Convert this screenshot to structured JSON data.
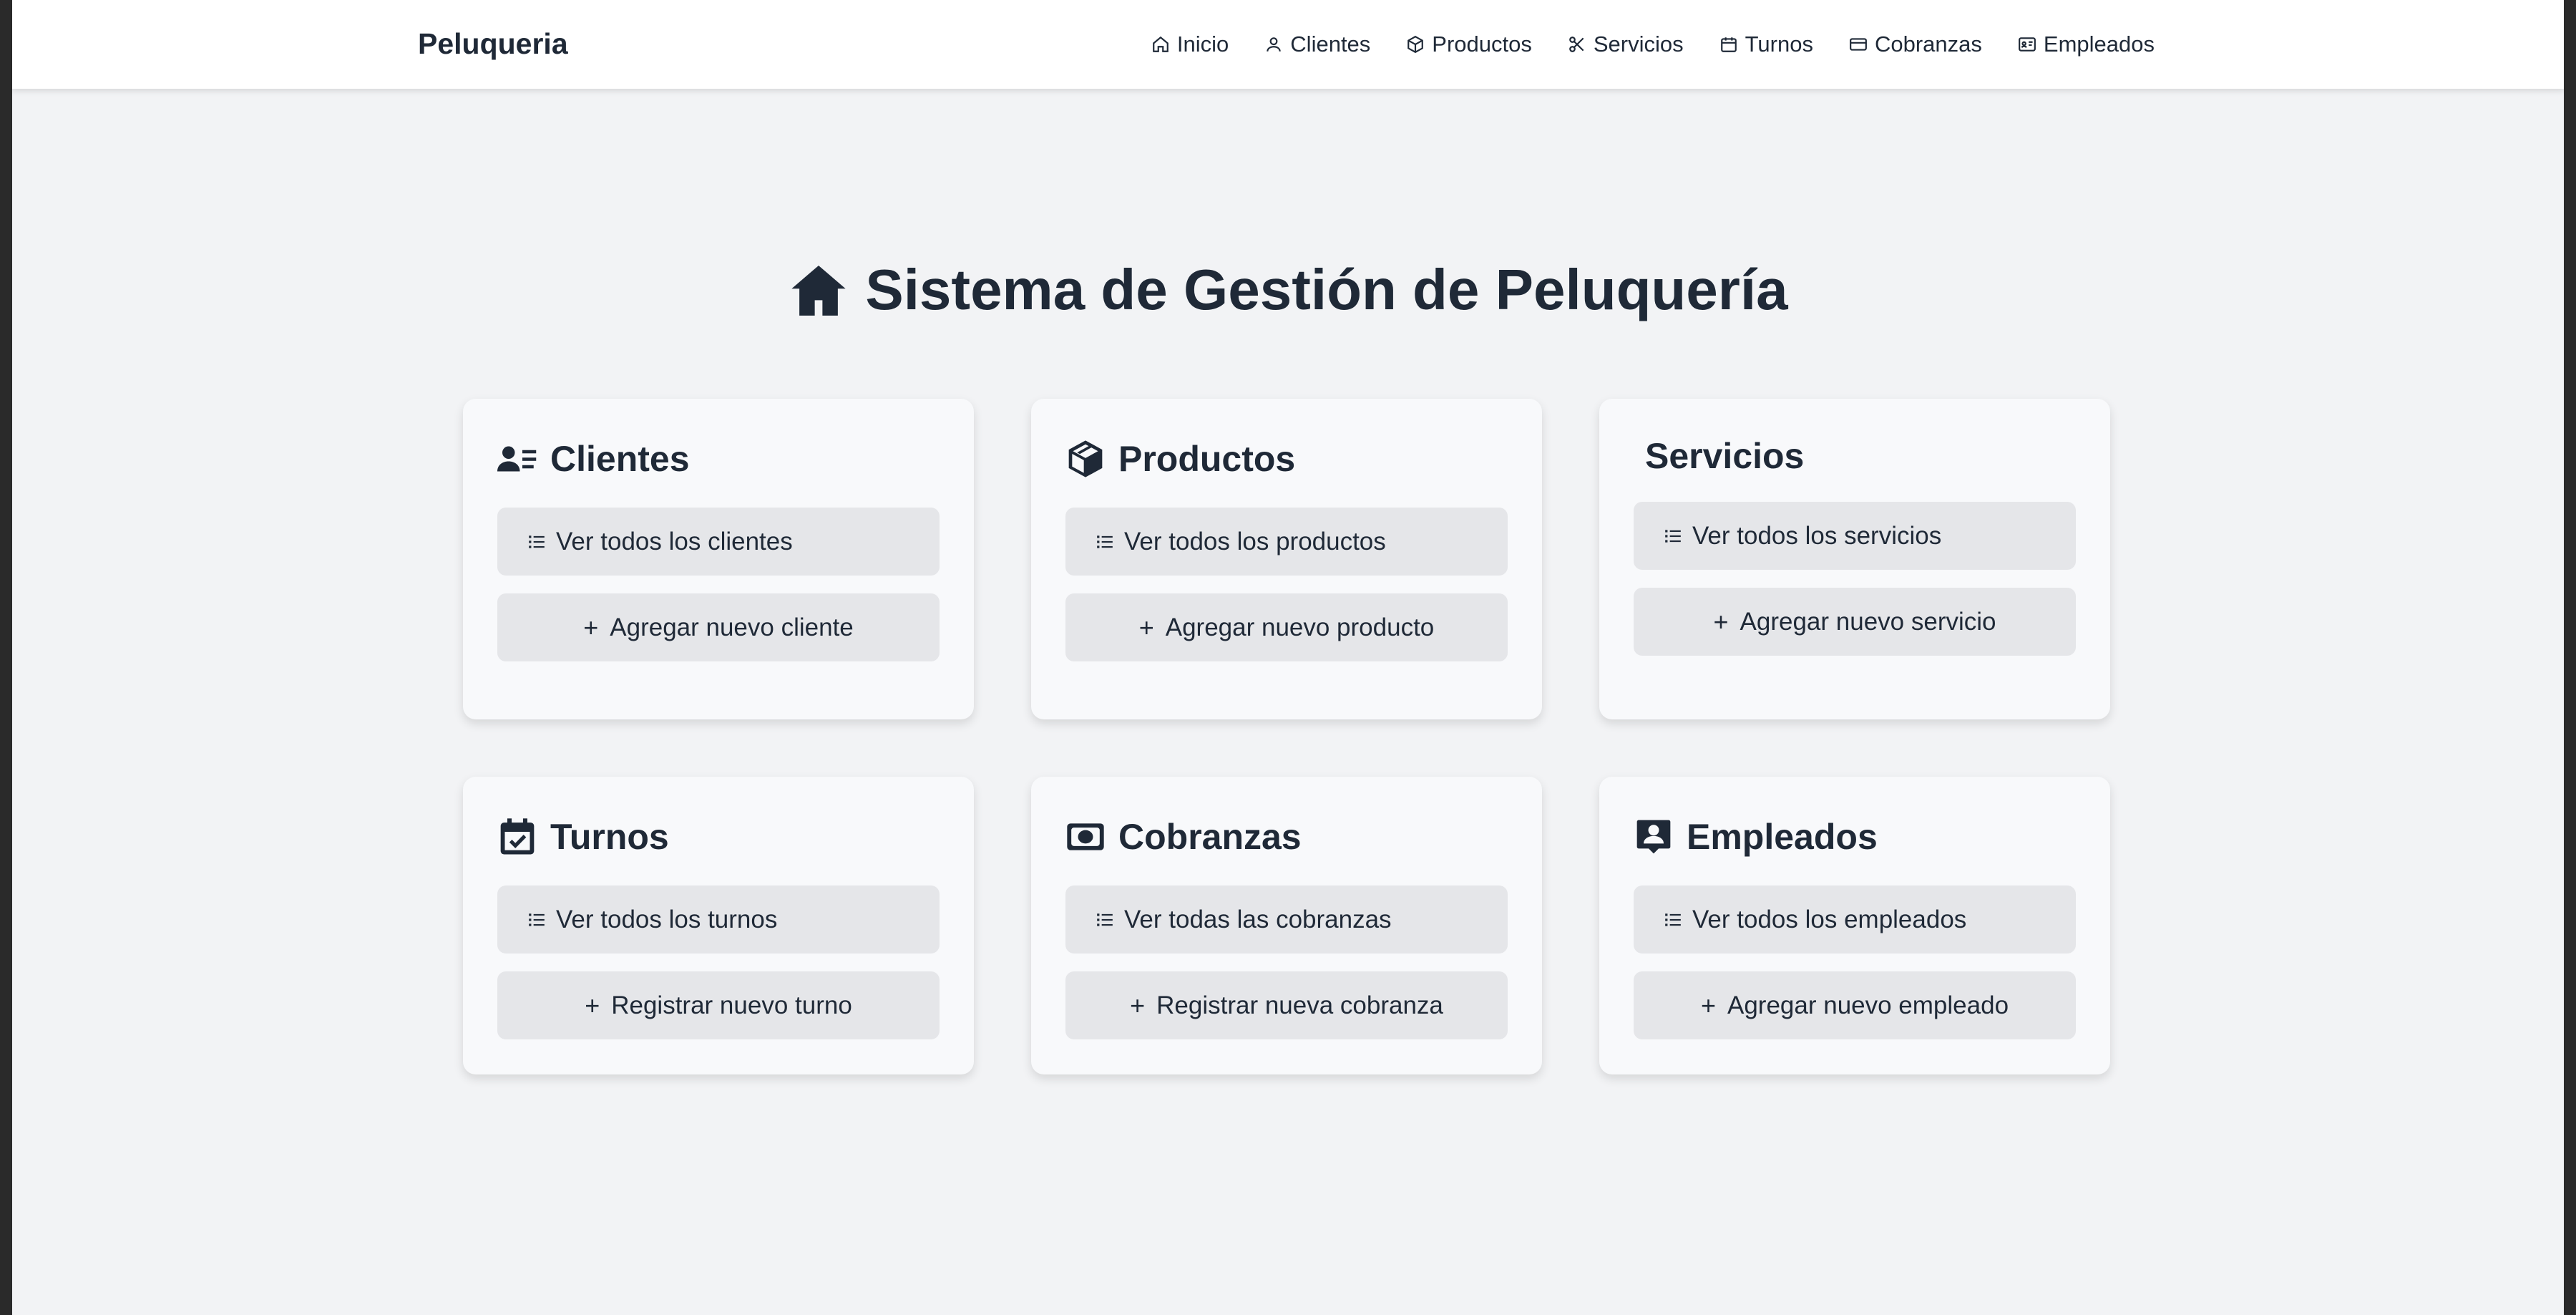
{
  "brand": "Peluqueria",
  "nav": [
    {
      "label": "Inicio",
      "icon": "home-icon"
    },
    {
      "label": "Clientes",
      "icon": "user-icon"
    },
    {
      "label": "Productos",
      "icon": "box-icon"
    },
    {
      "label": "Servicios",
      "icon": "scissors-icon"
    },
    {
      "label": "Turnos",
      "icon": "calendar-icon"
    },
    {
      "label": "Cobranzas",
      "icon": "credit-card-icon"
    },
    {
      "label": "Empleados",
      "icon": "id-card-icon"
    }
  ],
  "title": "Sistema de Gestión de Peluquería",
  "title_icon": "home-solid-icon",
  "cards": [
    {
      "title": "Clientes",
      "icon": "address-card-icon",
      "list_label": "Ver todos los clientes",
      "add_label": "Agregar nuevo cliente"
    },
    {
      "title": "Productos",
      "icon": "box-open-icon",
      "list_label": "Ver todos los productos",
      "add_label": "Agregar nuevo producto"
    },
    {
      "title": "Servicios",
      "icon": "",
      "list_label": "Ver todos los servicios",
      "add_label": "Agregar nuevo servicio"
    },
    {
      "title": "Turnos",
      "icon": "calendar-check-icon",
      "list_label": "Ver todos los turnos",
      "add_label": "Registrar nuevo turno"
    },
    {
      "title": "Cobranzas",
      "icon": "money-bill-icon",
      "list_label": "Ver todas las cobranzas",
      "add_label": "Registrar nueva cobranza"
    },
    {
      "title": "Empleados",
      "icon": "employee-badge-icon",
      "list_label": "Ver todos los empleados",
      "add_label": "Agregar nuevo empleado"
    }
  ],
  "colors": {
    "text": "#1f2937",
    "background": "#f2f3f5",
    "card": "#f8f9fb",
    "button": "#e5e6e9"
  }
}
